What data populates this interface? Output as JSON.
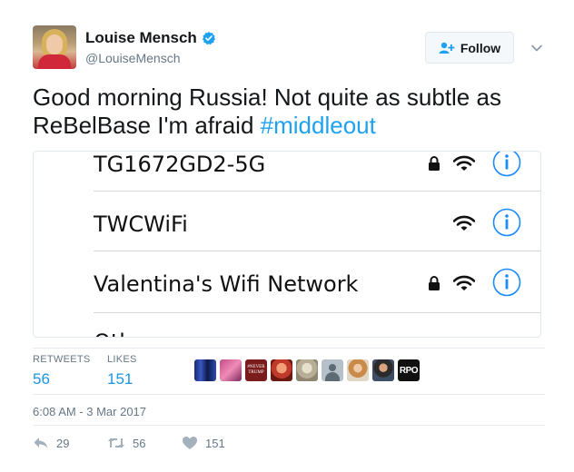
{
  "user": {
    "display_name": "Louise Mensch",
    "handle": "@LouiseMensch"
  },
  "follow_label": "Follow",
  "tweet": {
    "text": "Good morning Russia! Not quite as subtle as ReBelBase I'm afraid ",
    "hashtag": "#middleout"
  },
  "wifi_networks": [
    {
      "ssid": "TG1672GD2-5G",
      "locked": true
    },
    {
      "ssid": "TWCWiFi",
      "locked": false
    },
    {
      "ssid": "Valentina's Wifi Network",
      "locked": true
    },
    {
      "ssid": "Oth",
      "locked": false
    }
  ],
  "stats": {
    "retweets_label": "RETWEETS",
    "retweets": "56",
    "likes_label": "LIKES",
    "likes": "151"
  },
  "likers": {
    "never_trump_text": "#NEVER TRUMP",
    "rpo_text": "RPO"
  },
  "timestamp": "6:08 AM - 3 Mar 2017",
  "actions": {
    "reply_count": "29",
    "retweet_count": "56",
    "like_count": "151"
  },
  "colors": {
    "accent": "#1da1f2",
    "stat_value": "#1b95e0",
    "muted": "#657786"
  }
}
